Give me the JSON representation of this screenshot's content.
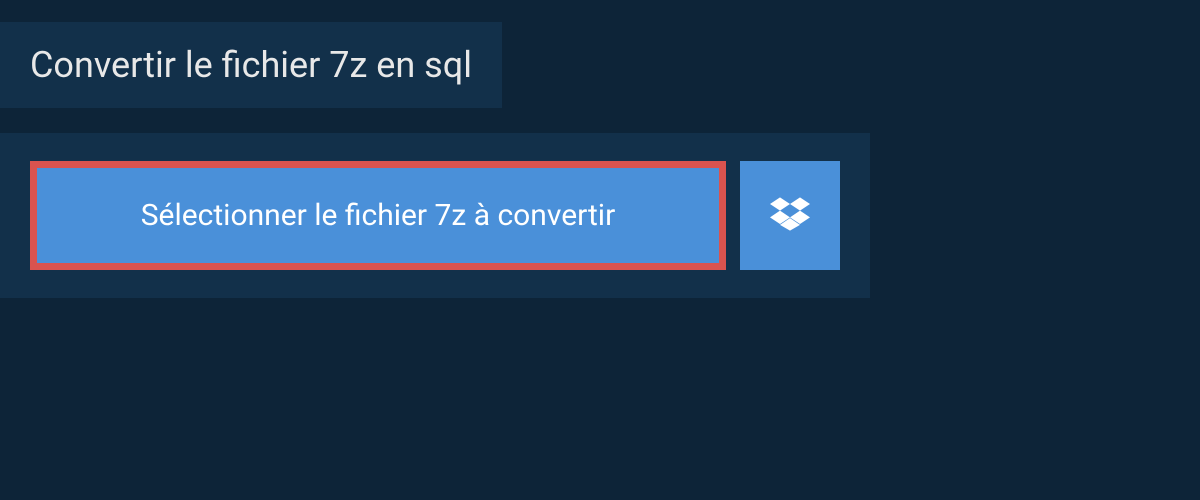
{
  "header": {
    "title": "Convertir le fichier 7z en sql"
  },
  "upload": {
    "select_file_label": "Sélectionner le fichier 7z à convertir"
  }
}
